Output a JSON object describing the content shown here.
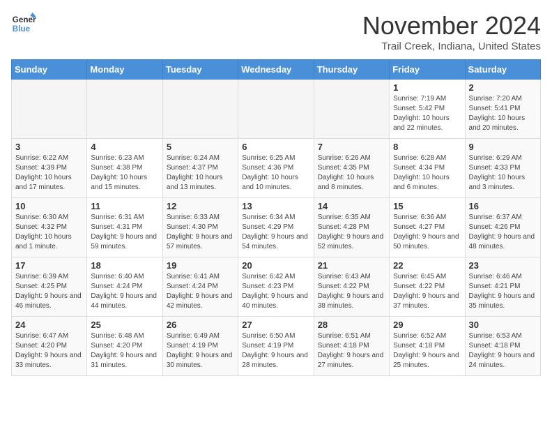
{
  "header": {
    "logo_line1": "General",
    "logo_line2": "Blue",
    "month_title": "November 2024",
    "location": "Trail Creek, Indiana, United States"
  },
  "days_of_week": [
    "Sunday",
    "Monday",
    "Tuesday",
    "Wednesday",
    "Thursday",
    "Friday",
    "Saturday"
  ],
  "weeks": [
    [
      {
        "day": "",
        "info": ""
      },
      {
        "day": "",
        "info": ""
      },
      {
        "day": "",
        "info": ""
      },
      {
        "day": "",
        "info": ""
      },
      {
        "day": "",
        "info": ""
      },
      {
        "day": "1",
        "info": "Sunrise: 7:19 AM\nSunset: 5:42 PM\nDaylight: 10 hours and 22 minutes."
      },
      {
        "day": "2",
        "info": "Sunrise: 7:20 AM\nSunset: 5:41 PM\nDaylight: 10 hours and 20 minutes."
      }
    ],
    [
      {
        "day": "3",
        "info": "Sunrise: 6:22 AM\nSunset: 4:39 PM\nDaylight: 10 hours and 17 minutes."
      },
      {
        "day": "4",
        "info": "Sunrise: 6:23 AM\nSunset: 4:38 PM\nDaylight: 10 hours and 15 minutes."
      },
      {
        "day": "5",
        "info": "Sunrise: 6:24 AM\nSunset: 4:37 PM\nDaylight: 10 hours and 13 minutes."
      },
      {
        "day": "6",
        "info": "Sunrise: 6:25 AM\nSunset: 4:36 PM\nDaylight: 10 hours and 10 minutes."
      },
      {
        "day": "7",
        "info": "Sunrise: 6:26 AM\nSunset: 4:35 PM\nDaylight: 10 hours and 8 minutes."
      },
      {
        "day": "8",
        "info": "Sunrise: 6:28 AM\nSunset: 4:34 PM\nDaylight: 10 hours and 6 minutes."
      },
      {
        "day": "9",
        "info": "Sunrise: 6:29 AM\nSunset: 4:33 PM\nDaylight: 10 hours and 3 minutes."
      }
    ],
    [
      {
        "day": "10",
        "info": "Sunrise: 6:30 AM\nSunset: 4:32 PM\nDaylight: 10 hours and 1 minute."
      },
      {
        "day": "11",
        "info": "Sunrise: 6:31 AM\nSunset: 4:31 PM\nDaylight: 9 hours and 59 minutes."
      },
      {
        "day": "12",
        "info": "Sunrise: 6:33 AM\nSunset: 4:30 PM\nDaylight: 9 hours and 57 minutes."
      },
      {
        "day": "13",
        "info": "Sunrise: 6:34 AM\nSunset: 4:29 PM\nDaylight: 9 hours and 54 minutes."
      },
      {
        "day": "14",
        "info": "Sunrise: 6:35 AM\nSunset: 4:28 PM\nDaylight: 9 hours and 52 minutes."
      },
      {
        "day": "15",
        "info": "Sunrise: 6:36 AM\nSunset: 4:27 PM\nDaylight: 9 hours and 50 minutes."
      },
      {
        "day": "16",
        "info": "Sunrise: 6:37 AM\nSunset: 4:26 PM\nDaylight: 9 hours and 48 minutes."
      }
    ],
    [
      {
        "day": "17",
        "info": "Sunrise: 6:39 AM\nSunset: 4:25 PM\nDaylight: 9 hours and 46 minutes."
      },
      {
        "day": "18",
        "info": "Sunrise: 6:40 AM\nSunset: 4:24 PM\nDaylight: 9 hours and 44 minutes."
      },
      {
        "day": "19",
        "info": "Sunrise: 6:41 AM\nSunset: 4:24 PM\nDaylight: 9 hours and 42 minutes."
      },
      {
        "day": "20",
        "info": "Sunrise: 6:42 AM\nSunset: 4:23 PM\nDaylight: 9 hours and 40 minutes."
      },
      {
        "day": "21",
        "info": "Sunrise: 6:43 AM\nSunset: 4:22 PM\nDaylight: 9 hours and 38 minutes."
      },
      {
        "day": "22",
        "info": "Sunrise: 6:45 AM\nSunset: 4:22 PM\nDaylight: 9 hours and 37 minutes."
      },
      {
        "day": "23",
        "info": "Sunrise: 6:46 AM\nSunset: 4:21 PM\nDaylight: 9 hours and 35 minutes."
      }
    ],
    [
      {
        "day": "24",
        "info": "Sunrise: 6:47 AM\nSunset: 4:20 PM\nDaylight: 9 hours and 33 minutes."
      },
      {
        "day": "25",
        "info": "Sunrise: 6:48 AM\nSunset: 4:20 PM\nDaylight: 9 hours and 31 minutes."
      },
      {
        "day": "26",
        "info": "Sunrise: 6:49 AM\nSunset: 4:19 PM\nDaylight: 9 hours and 30 minutes."
      },
      {
        "day": "27",
        "info": "Sunrise: 6:50 AM\nSunset: 4:19 PM\nDaylight: 9 hours and 28 minutes."
      },
      {
        "day": "28",
        "info": "Sunrise: 6:51 AM\nSunset: 4:18 PM\nDaylight: 9 hours and 27 minutes."
      },
      {
        "day": "29",
        "info": "Sunrise: 6:52 AM\nSunset: 4:18 PM\nDaylight: 9 hours and 25 minutes."
      },
      {
        "day": "30",
        "info": "Sunrise: 6:53 AM\nSunset: 4:18 PM\nDaylight: 9 hours and 24 minutes."
      }
    ]
  ]
}
